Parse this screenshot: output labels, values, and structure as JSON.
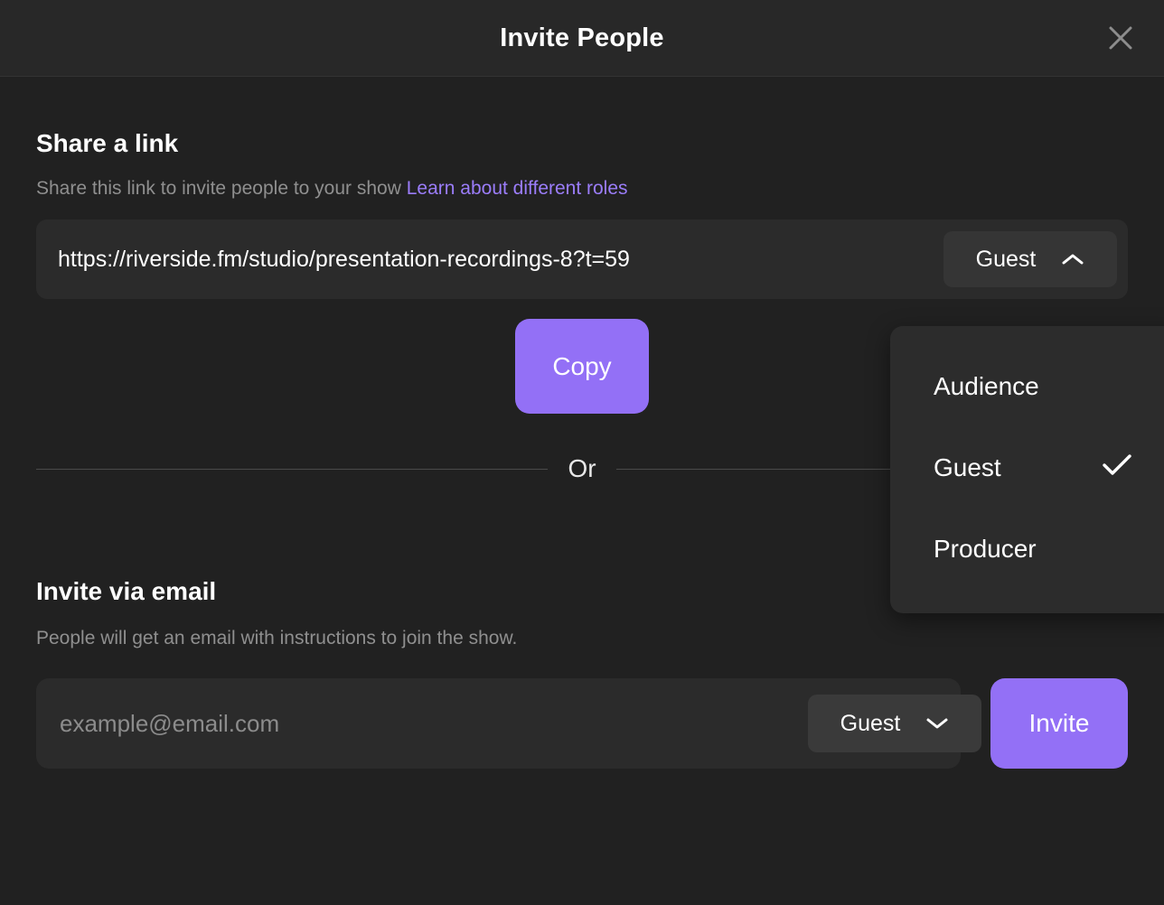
{
  "header": {
    "title": "Invite People",
    "close_icon": "close-icon"
  },
  "share_section": {
    "title": "Share a link",
    "description": "Share this link to invite people to your show",
    "link_text": "Learn about different roles",
    "link_value": "https://riverside.fm/studio/presentation-recordings-8?t=59",
    "role_selected": "Guest",
    "role_chevron_icon": "chevron-up-icon",
    "copy_label": "Copy"
  },
  "divider": {
    "label": "Or"
  },
  "email_section": {
    "title": "Invite via email",
    "description": "People will get an email with instructions to join the show.",
    "email_placeholder": "example@email.com",
    "email_value": "",
    "role_selected": "Guest",
    "role_chevron_icon": "chevron-down-icon",
    "invite_label": "Invite"
  },
  "role_menu": {
    "open": true,
    "selected": "Guest",
    "check_icon": "check-icon",
    "items": [
      {
        "label": "Audience",
        "selected": false
      },
      {
        "label": "Guest",
        "selected": true
      },
      {
        "label": "Producer",
        "selected": false
      }
    ]
  },
  "colors": {
    "accent": "#9370F6",
    "link": "#9B7DFA",
    "background": "#212121",
    "header_background": "#282828",
    "field_background": "#2B2B2B",
    "menu_background": "#2C2C2C",
    "muted_text": "#8F8F8F"
  }
}
